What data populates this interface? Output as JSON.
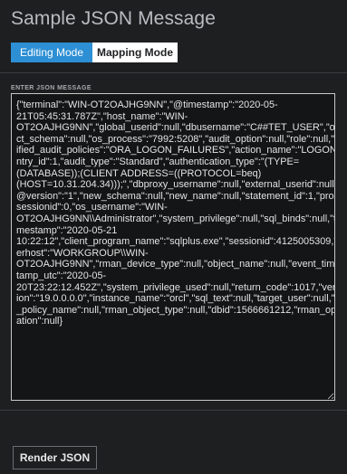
{
  "header": {
    "title": "Sample JSON Message"
  },
  "tabs": [
    {
      "label": "Editing Mode",
      "active": true
    },
    {
      "label": "Mapping Mode",
      "active": false
    }
  ],
  "editor": {
    "label": "ENTER JSON MESSAGE",
    "value": "{\"terminal\":\"WIN-OT2OAJHG9NN\",\"@timestamp\":\"2020-05-\n21T05:45:31.787Z\",\"host_name\":\"WIN-\nOT2OAJHG9NN\",\"global_userid\":null,\"dbusername\":\"C##TET_USER\",\"obje\nct_schema\":null,\"os_process\":\"7992:5208\",\"audit_option\":null,\"role\":null,\"un\nified_audit_policies\":\"ORA_LOGON_FAILURES\",\"action_name\":\"LOGON\",\"e\nntry_id\":1,\"audit_type\":\"Standard\",\"authentication_type\":\"(TYPE=\n(DATABASE));(CLIENT ADDRESS=((PROTOCOL=beq)\n(HOST=10.31.204.34)));\",\"dbproxy_username\":null,\"external_userid\":null,\"\n@version\":\"1\",\"new_schema\":null,\"new_name\":null,\"statement_id\":1,\"proxy_\nsessionid\":0,\"os_username\":\"WIN-\nOT2OAJHG9NN\\\\Administrator\",\"system_privilege\":null,\"sql_binds\":null,\"ti\nmestamp\":\"2020-05-21\n10:22:12\",\"client_program_name\":\"sqlplus.exe\",\"sessionid\":4125005309,\"us\nerhost\":\"WORKGROUP\\\\WIN-\nOT2OAJHG9NN\",\"rman_device_type\":null,\"object_name\":null,\"event_times\ntamp_utc\":\"2020-05-\n20T23:22:12.452Z\",\"system_privilege_used\":null,\"return_code\":1017,\"vers\nion\":\"19.0.0.0.0\",\"instance_name\":\"orcl\",\"sql_text\":null,\"target_user\":null,\"fga\n_policy_name\":null,\"rman_object_type\":null,\"dbid\":1566661212,\"rman_oper\nation\":null}"
  },
  "actions": {
    "render_label": "Render JSON"
  }
}
